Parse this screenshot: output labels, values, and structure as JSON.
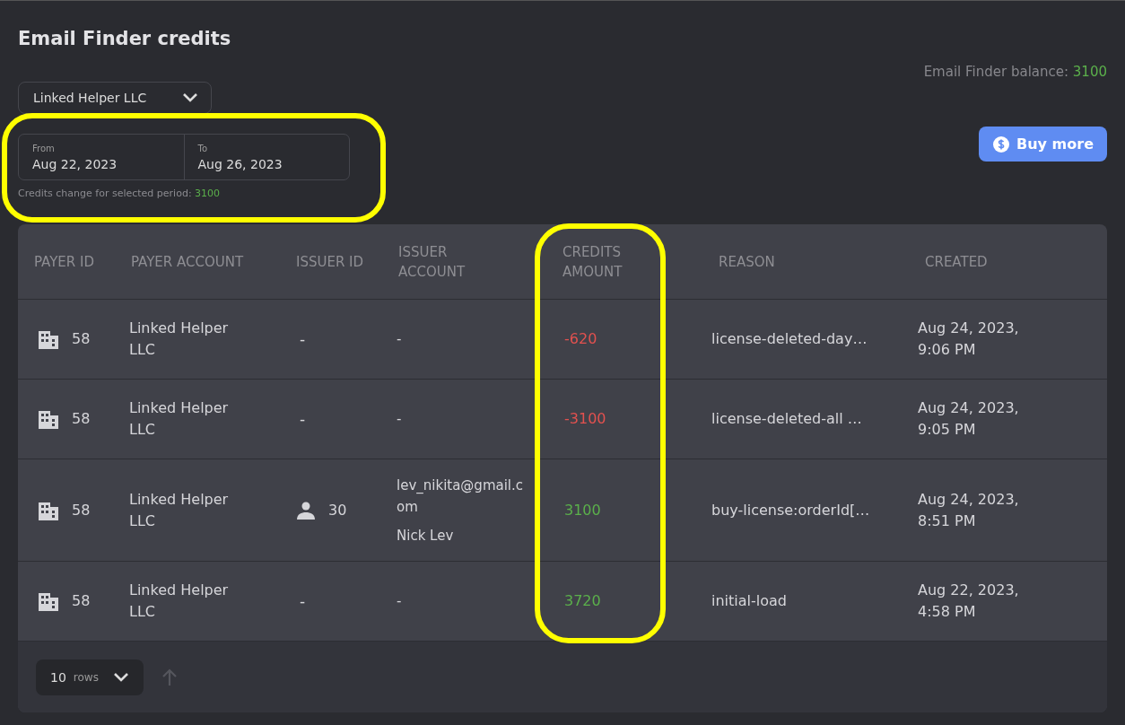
{
  "title": "Email Finder credits",
  "account_select": {
    "value": "Linked Helper LLC"
  },
  "balance": {
    "label": "Email Finder balance:",
    "value": "3100"
  },
  "date_range": {
    "from": {
      "label": "From",
      "value": "Aug 22, 2023"
    },
    "to": {
      "label": "To",
      "value": "Aug 26, 2023"
    }
  },
  "period_change": {
    "label": "Credits change for selected period:",
    "value": "3100"
  },
  "buy_button": "Buy more",
  "table": {
    "columns": [
      "PAYER ID",
      "PAYER ACCOUNT",
      "ISSUER ID",
      "ISSUER ACCOUNT",
      "CREDITS AMOUNT",
      "REASON",
      "CREATED"
    ],
    "rows": [
      {
        "payer_id": "58",
        "payer_account": "Linked Helper LLC",
        "issuer_id": {
          "kind": "none",
          "value": "-"
        },
        "issuer_account": [
          "-"
        ],
        "amount": "-620",
        "color": "#e2514f",
        "reason": "license-deleted-day…",
        "created": "Aug 24, 2023, 9:06 PM"
      },
      {
        "payer_id": "58",
        "payer_account": "Linked Helper LLC",
        "issuer_id": {
          "kind": "none",
          "value": "-"
        },
        "issuer_account": [
          "-"
        ],
        "amount": "-3100",
        "color": "#e2514f",
        "reason": "license-deleted-all …",
        "created": "Aug 24, 2023, 9:05 PM"
      },
      {
        "payer_id": "58",
        "payer_account": "Linked Helper LLC",
        "issuer_id": {
          "kind": "user",
          "value": "30"
        },
        "issuer_account": [
          "lev_nikita@gmail.com",
          "Nick Lev"
        ],
        "amount": "3100",
        "color": "#5bb04b",
        "reason": "buy-license:orderId[…",
        "created": "Aug 24, 2023, 8:51 PM"
      },
      {
        "payer_id": "58",
        "payer_account": "Linked Helper LLC",
        "issuer_id": {
          "kind": "none",
          "value": "-"
        },
        "issuer_account": [
          "-"
        ],
        "amount": "3720",
        "color": "#5bb04b",
        "reason": "initial-load",
        "created": "Aug 22, 2023, 4:58 PM"
      }
    ]
  },
  "pager": {
    "count": "10",
    "unit": "rows"
  }
}
